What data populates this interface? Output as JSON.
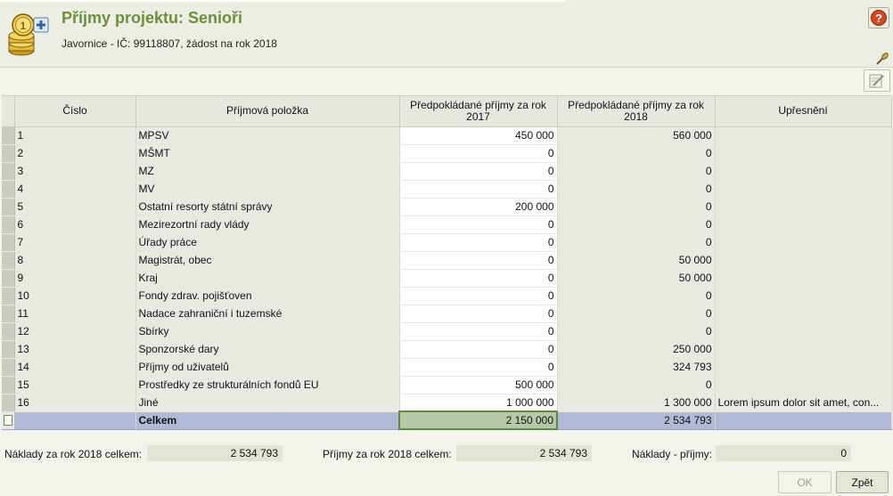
{
  "header": {
    "title": "Příjmy projektu: Senioři",
    "subtitle": "Javornice - IČ: 99118807, žádost na rok 2018",
    "help_label": "?"
  },
  "table": {
    "columns": [
      "Číslo",
      "Příjmová položka",
      "Předpokládané příjmy za rok 2017",
      "Předpokládané příjmy za rok 2018",
      "Upřesnění"
    ],
    "rows": [
      {
        "num": "1",
        "item": "MPSV",
        "y2017": "450 000",
        "y2018": "560 000",
        "note": ""
      },
      {
        "num": "2",
        "item": "MŠMT",
        "y2017": "0",
        "y2018": "0",
        "note": ""
      },
      {
        "num": "3",
        "item": "MZ",
        "y2017": "0",
        "y2018": "0",
        "note": ""
      },
      {
        "num": "4",
        "item": "MV",
        "y2017": "0",
        "y2018": "0",
        "note": ""
      },
      {
        "num": "5",
        "item": "Ostatní resorty státní správy",
        "y2017": "200 000",
        "y2018": "0",
        "note": ""
      },
      {
        "num": "6",
        "item": "Mezirezortní rady vlády",
        "y2017": "0",
        "y2018": "0",
        "note": ""
      },
      {
        "num": "7",
        "item": "Úřady práce",
        "y2017": "0",
        "y2018": "0",
        "note": ""
      },
      {
        "num": "8",
        "item": "Magistrát, obec",
        "y2017": "0",
        "y2018": "50 000",
        "note": ""
      },
      {
        "num": "9",
        "item": "Kraj",
        "y2017": "0",
        "y2018": "50 000",
        "note": ""
      },
      {
        "num": "10",
        "item": "Fondy zdrav. pojišťoven",
        "y2017": "0",
        "y2018": "0",
        "note": ""
      },
      {
        "num": "11",
        "item": "Nadace zahraniční i tuzemské",
        "y2017": "0",
        "y2018": "0",
        "note": ""
      },
      {
        "num": "12",
        "item": "Sbírky",
        "y2017": "0",
        "y2018": "0",
        "note": ""
      },
      {
        "num": "13",
        "item": "Sponzorské dary",
        "y2017": "0",
        "y2018": "250 000",
        "note": ""
      },
      {
        "num": "14",
        "item": "Příjmy od uživatelů",
        "y2017": "0",
        "y2018": "324 793",
        "note": ""
      },
      {
        "num": "15",
        "item": "Prostředky ze strukturálních fondů EU",
        "y2017": "500 000",
        "y2018": "0",
        "note": ""
      },
      {
        "num": "16",
        "item": "Jiné",
        "y2017": "1 000 000",
        "y2018": "1 300 000",
        "note": "Lorem ipsum dolor sit amet, con..."
      }
    ],
    "total": {
      "label": "Celkem",
      "y2017": "2 150 000",
      "y2018": "2 534 793"
    }
  },
  "footer": {
    "costs_label": "Náklady za rok 2018 celkem:",
    "costs_value": "2 534 793",
    "income_label": "Příjmy za rok 2018 celkem:",
    "income_value": "2 534 793",
    "diff_label": "Náklady - příjmy:",
    "diff_value": "0"
  },
  "buttons": {
    "ok": "OK",
    "back": "Zpět"
  },
  "colors": {
    "title": "#6b8f3a",
    "total_row": "#b2b9d6",
    "active_cell_border": "#5f8a46"
  }
}
